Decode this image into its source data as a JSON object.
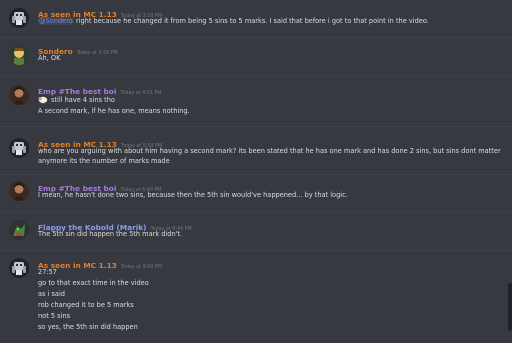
{
  "colors": {
    "background": "#36393f",
    "text": "#dcddde",
    "timestamp": "#72767d",
    "mention": "#7289da",
    "author_orange": "#e67e22",
    "author_purple": "#a67bd8",
    "author_blue": "#8e9bf0"
  },
  "messages": [
    {
      "author": "As seen in MC 1.13",
      "time": "Today at 3:59 PM",
      "mention": "@Sondero",
      "lines": [
        " right because he changed it from being 5 sins to 5 marks. I said that before i got to that point in the video."
      ]
    },
    {
      "author": "Sondero",
      "time": "Today at 3:59 PM",
      "lines": [
        "Ah, OK"
      ]
    },
    {
      "author": "Emp #The best boi",
      "time": "Today at 4:01 PM",
      "emoji": "sheep-emoji",
      "lines": [
        "still have 4 sins tho",
        "A second mark, if he has one, means nothing."
      ]
    },
    {
      "author": "As seen in MC 1.13",
      "time": "Today at 5:59 PM",
      "lines": [
        "who are you arguing with about him having a second mark? its been stated that he has one mark and has done 2 sins, but sins dont matter anymore its the number of marks made"
      ]
    },
    {
      "author": "Emp #The best boi",
      "time": "Today at 6:40 PM",
      "lines": [
        "I mean, he hasn't done two sins, because then the 5th sin would've happened... by that logic."
      ]
    },
    {
      "author": "Flappy the Kobold (Marik)",
      "time": "Today at 8:44 PM",
      "lines": [
        "The 5th sin did happen the 5th mark didn't."
      ]
    },
    {
      "author": "As seen in MC 1.13",
      "time": "Today at 9:00 PM",
      "lines": [
        "27:57",
        "go to that exact time in the video",
        "as i said",
        "rob changed it to be 5 marks",
        "not 5 sins",
        "so yes, the 5th sin did happen"
      ]
    }
  ]
}
